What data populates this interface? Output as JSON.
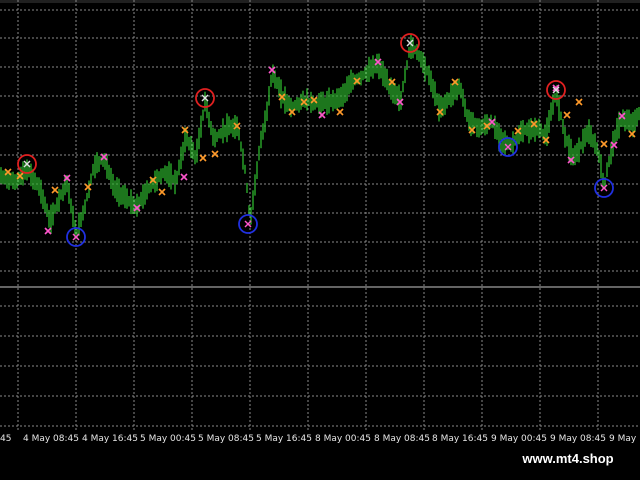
{
  "colors": {
    "background": "#000000",
    "grid": "#8a8a8a",
    "candle": "#2db52d",
    "separator": "#c8c8c8",
    "axis_text": "#e6e6e6",
    "peak_marker": "#e0e0e0",
    "buy_marker": "#ff55cc",
    "sell_marker": "#ff9a2a",
    "top_circle": "#e02020",
    "bottom_circle": "#2030e0"
  },
  "time_axis": {
    "labels": [
      "45",
      "4 May 08:45",
      "4 May 16:45",
      "5 May 00:45",
      "5 May 08:45",
      "5 May 16:45",
      "8 May 00:45",
      "8 May 08:45",
      "8 May 16:45",
      "9 May 00:45",
      "9 May 08:45",
      "9 May 16:45"
    ]
  },
  "indicator": {
    "top_circles": 4,
    "bottom_circles": 4
  },
  "watermark": {
    "text": "www.mt4.shop"
  }
}
